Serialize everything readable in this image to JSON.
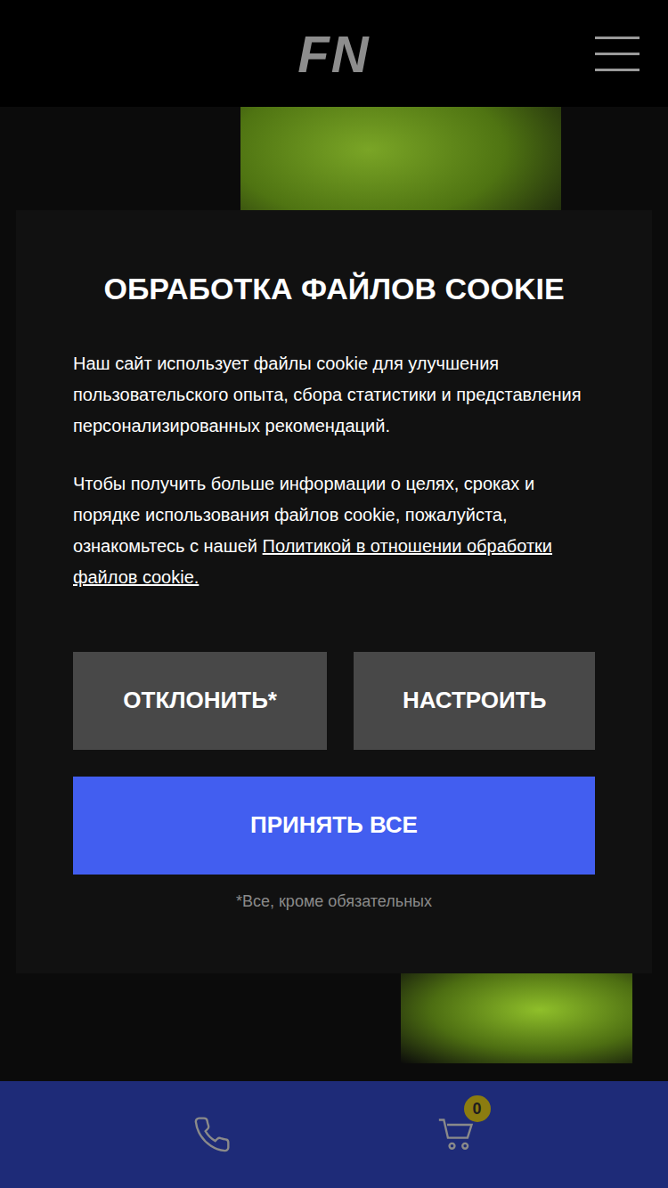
{
  "header": {
    "logo": "FN"
  },
  "cookie_dialog": {
    "title": "ОБРАБОТКА ФАЙЛОВ COOKIE",
    "intro": "Наш сайт использует файлы cookie для улучшения пользовательского опыта, сбора статистики и представления персонализированных рекомендаций.",
    "details": {
      "text": "Чтобы получить больше информации о целях, сроках и порядке использования файлов cookie, пожалуйста, ознакомьтесь с нашей ",
      "link": "Политикой в отношении обработки файлов cookie."
    },
    "buttons": {
      "decline": "ОТКЛОНИТЬ*",
      "customize": "НАСТРОИТЬ",
      "accept": "ПРИНЯТЬ ВСЕ"
    },
    "footnote": "*Все, кроме обязательных"
  },
  "bottom_bar": {
    "cart_count": "0"
  }
}
